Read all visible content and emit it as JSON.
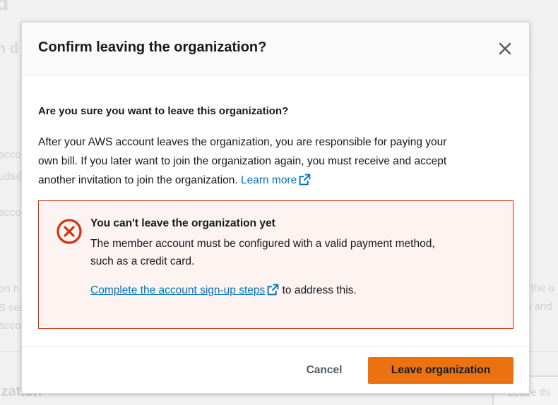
{
  "background": {
    "fragments": [
      "d",
      "n d",
      "accou",
      "uds@",
      "accou",
      "on h",
      "S ser",
      "accou",
      "n the o",
      "n and",
      "ization",
      "Leave thi"
    ]
  },
  "modal": {
    "title": "Confirm leaving the organization?",
    "close_icon": "close-icon",
    "question": "Are you sure you want to leave this organization?",
    "description_lines": [
      "After your AWS account leaves the organization, you are responsible for paying your",
      "own bill. If you later want to join the organization again, you must receive and accept",
      "another invitation to join the organization. "
    ],
    "learn_more_label": "Learn more",
    "alert": {
      "type": "error",
      "icon": "error-circle-x-icon",
      "title": "You can't leave the organization yet",
      "body_lines": [
        "The member account must be configured with a valid payment method,",
        "such as a credit card."
      ],
      "action_link_label": "Complete the account sign-up steps",
      "action_suffix": " to address this.",
      "border_color": "#d13212",
      "background_color": "#fdf3f1"
    },
    "footer": {
      "cancel_label": "Cancel",
      "primary_label": "Leave organization",
      "primary_color": "#ec7211"
    }
  },
  "colors": {
    "link": "#0073bb",
    "text": "#16191f",
    "secondary_text": "#545b64"
  }
}
